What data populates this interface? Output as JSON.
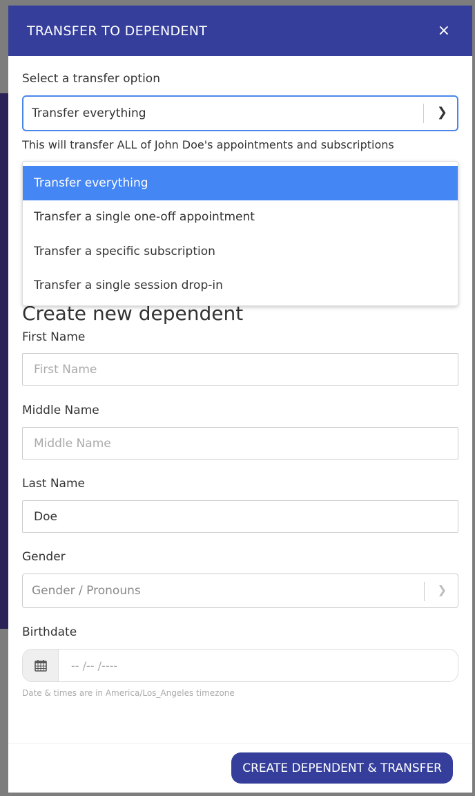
{
  "modal": {
    "title": "TRANSFER TO DEPENDENT",
    "close_label": "×"
  },
  "transfer": {
    "label": "Select a transfer option",
    "selected": "Transfer everything",
    "description": "This will transfer ALL of John Doe's appointments and subscriptions",
    "options": [
      "Transfer everything",
      "Transfer a single one-off appointment",
      "Transfer a specific subscription",
      "Transfer a single session drop-in"
    ]
  },
  "form": {
    "heading": "Create new dependent",
    "first_name": {
      "label": "First Name",
      "placeholder": "First Name",
      "value": ""
    },
    "middle_name": {
      "label": "Middle Name",
      "placeholder": "Middle Name",
      "value": ""
    },
    "last_name": {
      "label": "Last Name",
      "placeholder": "Last Name",
      "value": "Doe"
    },
    "gender": {
      "label": "Gender",
      "placeholder": "Gender / Pronouns"
    },
    "birthdate": {
      "label": "Birthdate",
      "placeholder": "--  /--  /----",
      "timezone_note": "Date & times are in America/Los_Angeles timezone"
    }
  },
  "footer": {
    "submit_label": "CREATE DEPENDENT & TRANSFER"
  },
  "colors": {
    "primary": "#353f9b",
    "selected_option": "#4486f4",
    "focus_border": "#4a86e8"
  }
}
